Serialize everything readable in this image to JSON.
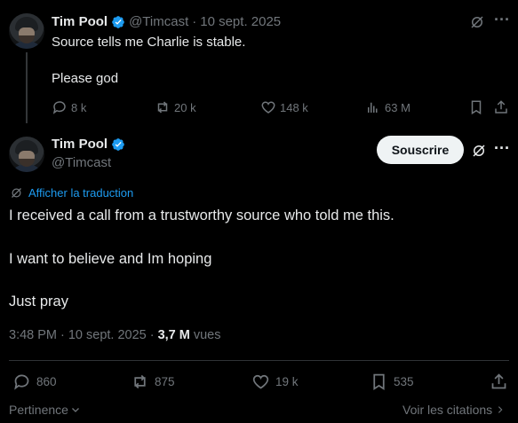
{
  "reply_tweet": {
    "name": "Tim Pool",
    "handle": "@Timcast",
    "date": "10 sept. 2025",
    "lines": [
      "Source tells me Charlie is stable.",
      "Please god"
    ],
    "stats": {
      "replies": "8 k",
      "reposts": "20 k",
      "likes": "148 k",
      "views": "63 M"
    }
  },
  "main_tweet": {
    "name": "Tim Pool",
    "handle": "@Timcast",
    "subscribe_label": "Souscrire",
    "translate_label": "Afficher la traduction",
    "lines": [
      "I received a call from a trustworthy source who told me this.",
      "I want to believe and Im hoping",
      "Just pray"
    ],
    "time": "3:48 PM",
    "date": "10 sept. 2025",
    "views_count": "3,7 M",
    "views_label": "vues",
    "stats": {
      "replies": "860",
      "reposts": "875",
      "likes": "19 k",
      "bookmarks": "535"
    }
  },
  "footer": {
    "sort_label": "Pertinence",
    "quotes_label": "Voir les citations"
  },
  "colors": {
    "background": "#000000",
    "text": "#e7e9ea",
    "muted": "#71767b",
    "accent": "#1d9bf0",
    "divider": "#2f3336"
  }
}
